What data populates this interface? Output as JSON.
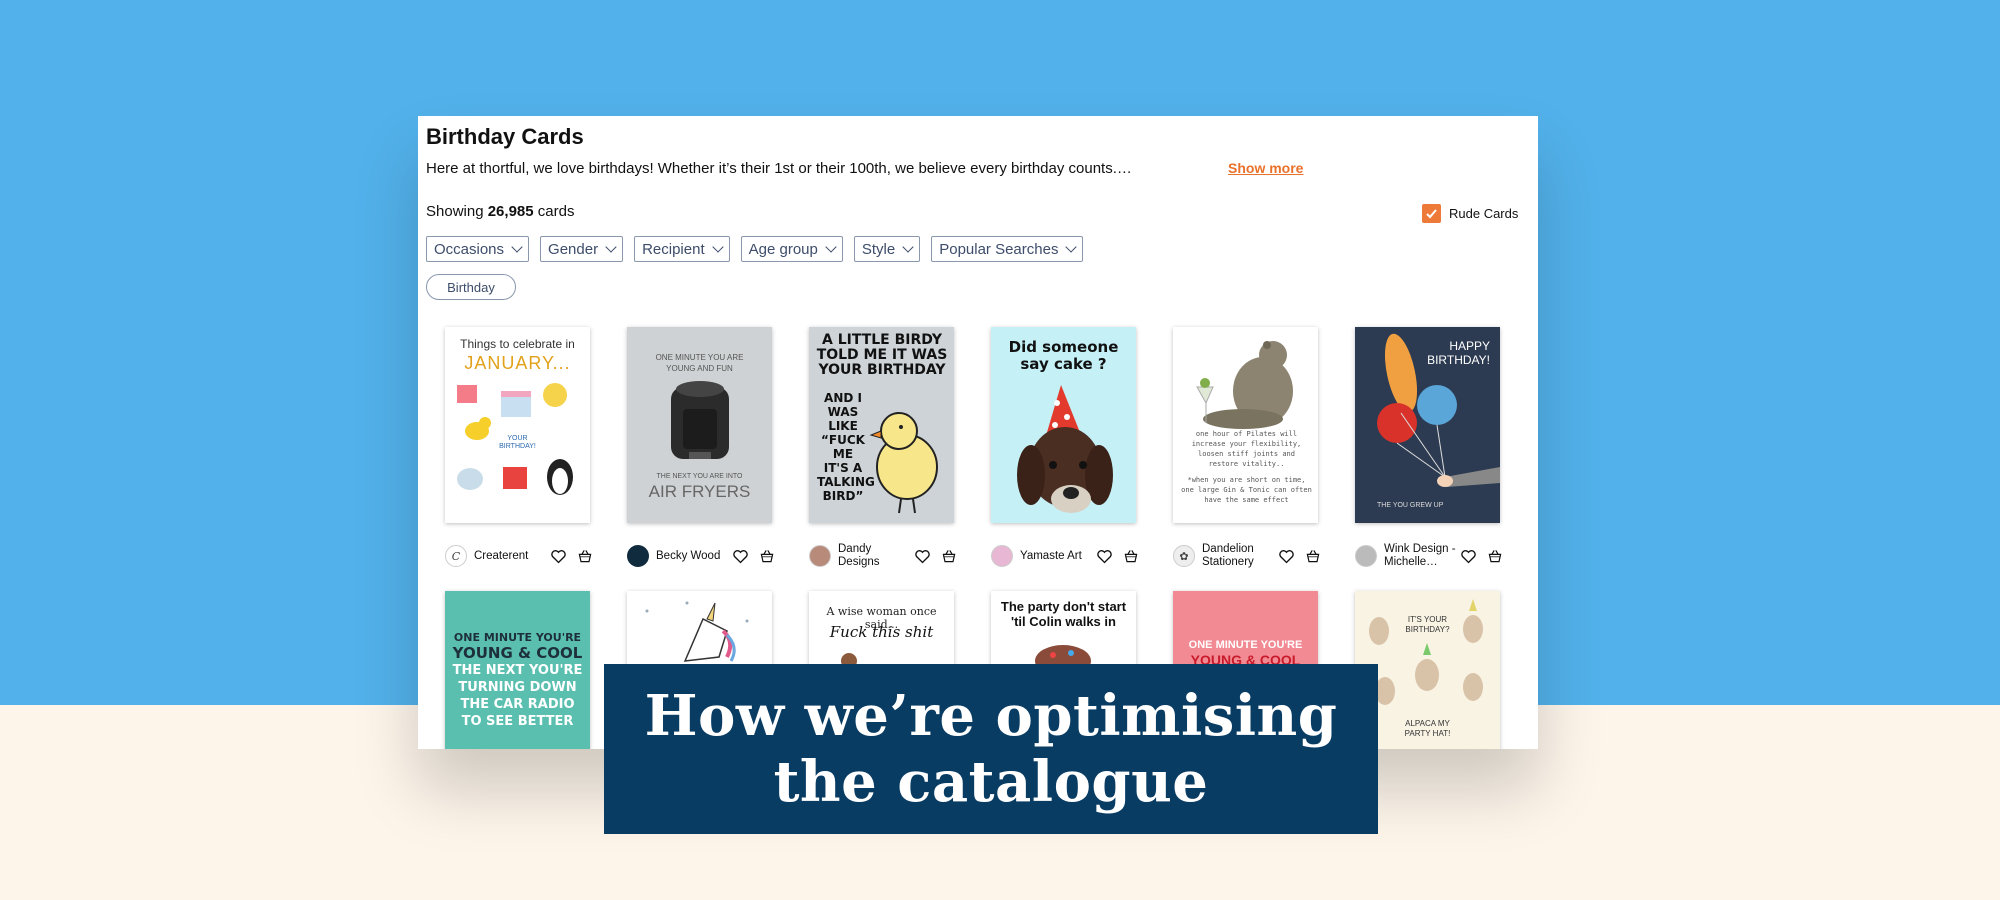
{
  "page": {
    "title": "Birthday Cards",
    "description": "Here at thortful, we love birthdays! Whether it’s their 1st or their 100th, we believe every birthday counts.…",
    "show_more": "Show more",
    "count_prefix": "Showing",
    "count": "26,985",
    "count_suffix": "cards",
    "rude_label": "Rude Cards",
    "rude_checked": true,
    "accent_color": "#e8712b"
  },
  "filters": [
    "Occasions",
    "Gender",
    "Recipient",
    "Age group",
    "Style",
    "Popular Searches"
  ],
  "active_chip": "Birthday",
  "cards_row1": [
    {
      "artist": "Createrent",
      "avatar_icon": "c-logo-icon",
      "text": [
        "Things to celebrate in",
        "JANUARY...",
        "YOUR",
        "BIRTHDAY!"
      ]
    },
    {
      "artist": "Becky Wood",
      "avatar_icon": "dark-logo-icon",
      "text": [
        "ONE MINUTE YOU ARE",
        "YOUNG AND FUN",
        "THE NEXT YOU ARE INTO",
        "AIR FRYERS"
      ]
    },
    {
      "artist": "Dandy Designs",
      "avatar_icon": "portrait-icon",
      "text": [
        "A LITTLE BIRDY",
        "TOLD ME IT WAS",
        "YOUR BIRTHDAY",
        "AND I",
        "WAS",
        "LIKE",
        "“FUCK",
        "ME",
        "IT'S A",
        "TALKING",
        "BIRD”"
      ]
    },
    {
      "artist": "Yamaste Art",
      "avatar_icon": "portrait-icon",
      "text": [
        "Did someone",
        "say cake ?"
      ]
    },
    {
      "artist": "Dandelion Stationery",
      "avatar_icon": "leaf-logo-icon",
      "text": [
        "one hour of Pilates will",
        "increase your flexibility,",
        "loosen stiff joints and",
        "restore vitality..",
        "*when you are short on time,",
        "one large Gin & Tonic can often",
        "have the same effect"
      ]
    },
    {
      "artist": "Wink Design - Michelle…",
      "avatar_icon": "portrait-icon",
      "text": [
        "HAPPY",
        "BIRTHDAY!",
        "THE YOU GREW UP"
      ]
    }
  ],
  "cards_row2": [
    {
      "text": [
        "ONE MINUTE YOU'RE",
        "YOUNG & COOL",
        "THE NEXT YOU'RE",
        "TURNING DOWN",
        "THE CAR RADIO",
        "TO SEE BETTER"
      ]
    },
    {
      "text": []
    },
    {
      "text": [
        "A wise woman once said...",
        "Fuck this shit"
      ]
    },
    {
      "text": [
        "The party don't start",
        "'til Colin walks in"
      ]
    },
    {
      "text": [
        "ONE MINUTE YOU'RE",
        "YOUNG & COOL"
      ]
    },
    {
      "text": [
        "IT'S YOUR",
        "BIRTHDAY?",
        "ALPACA MY",
        "PARTY HAT!"
      ]
    }
  ],
  "banner": {
    "line1": "How we’re optimising",
    "line2": "the catalogue"
  }
}
